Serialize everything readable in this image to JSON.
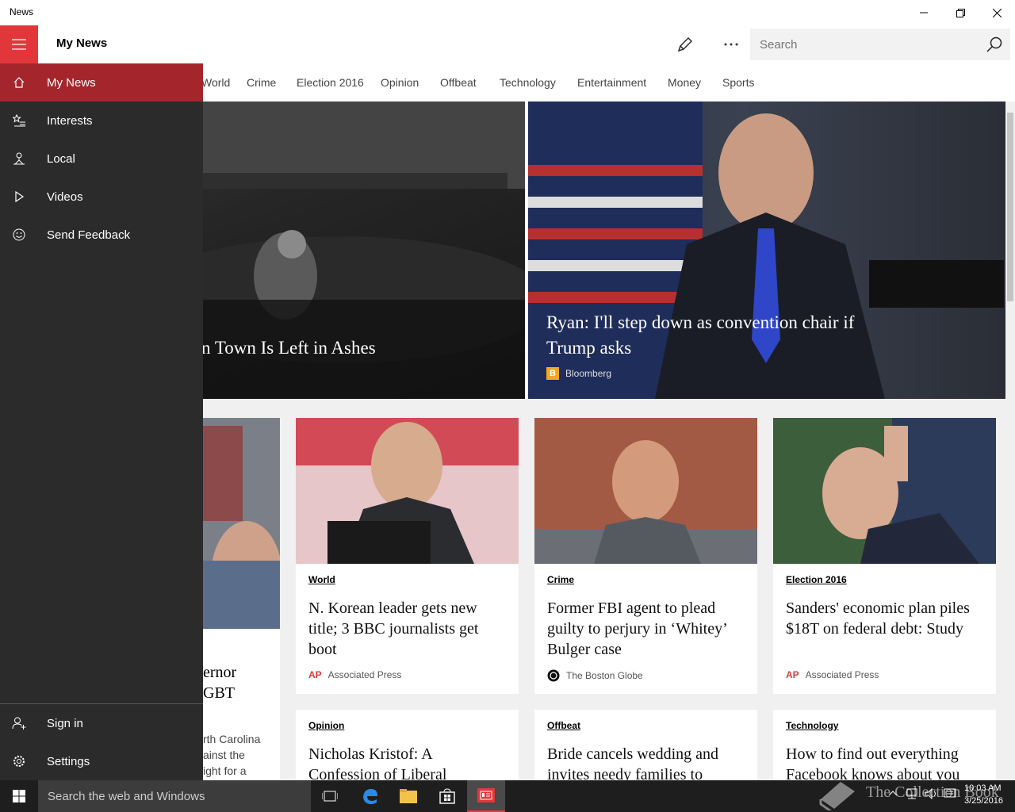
{
  "window": {
    "title": "News"
  },
  "header": {
    "title": "My News",
    "search_placeholder": "Search"
  },
  "categories": [
    "World",
    "Crime",
    "Election 2016",
    "Opinion",
    "Offbeat",
    "Technology",
    "Entertainment",
    "Money",
    "Sports"
  ],
  "hero": [
    {
      "title": "n Town Is Left in Ashes"
    },
    {
      "title": "Ryan: I'll step down as convention chair if Trump asks",
      "source": "Bloomberg",
      "source_icon": "B"
    }
  ],
  "cards_row1": [
    {
      "snippet_title_1": "ernor",
      "snippet_title_2": "GBT",
      "snippet_text_1": "rth Carolina",
      "snippet_text_2": "ainst the",
      "snippet_text_3": "ight for a"
    },
    {
      "category": "World",
      "title": "N. Korean leader gets new title; 3 BBC journalists get boot",
      "source": "Associated Press",
      "source_icon": "AP"
    },
    {
      "category": "Crime",
      "title": "Former FBI agent to plead guilty to perjury in ‘Whitey’ Bulger case",
      "source": "The Boston Globe"
    },
    {
      "category": "Election 2016",
      "title": "Sanders' economic plan piles $18T on federal debt: Study",
      "source": "Associated Press",
      "source_icon": "AP"
    }
  ],
  "cards_row2": [
    {
      "category": "Opinion",
      "title": "Nicholas Kristof: A Confession of Liberal"
    },
    {
      "category": "Offbeat",
      "title": "Bride cancels wedding and invites needy families to"
    },
    {
      "category": "Technology",
      "title": "How to find out everything Facebook knows about you"
    }
  ],
  "nav": {
    "items": [
      {
        "label": "My News",
        "icon": "home-icon"
      },
      {
        "label": "Interests",
        "icon": "star-list-icon"
      },
      {
        "label": "Local",
        "icon": "local-icon"
      },
      {
        "label": "Videos",
        "icon": "play-icon"
      },
      {
        "label": "Send Feedback",
        "icon": "smiley-icon"
      }
    ],
    "bottom": [
      {
        "label": "Sign in",
        "icon": "person-add-icon"
      },
      {
        "label": "Settings",
        "icon": "gear-icon"
      }
    ]
  },
  "taskbar": {
    "search_text": "Search the web and Windows",
    "watermark": "The Collection Book",
    "time": "10:03 AM",
    "date": "3/25/2016"
  },
  "colors": {
    "accent": "#e2373a",
    "nav_bg": "#2b2b2b",
    "nav_active": "#a4262c",
    "taskbar": "#1e1e1e"
  }
}
